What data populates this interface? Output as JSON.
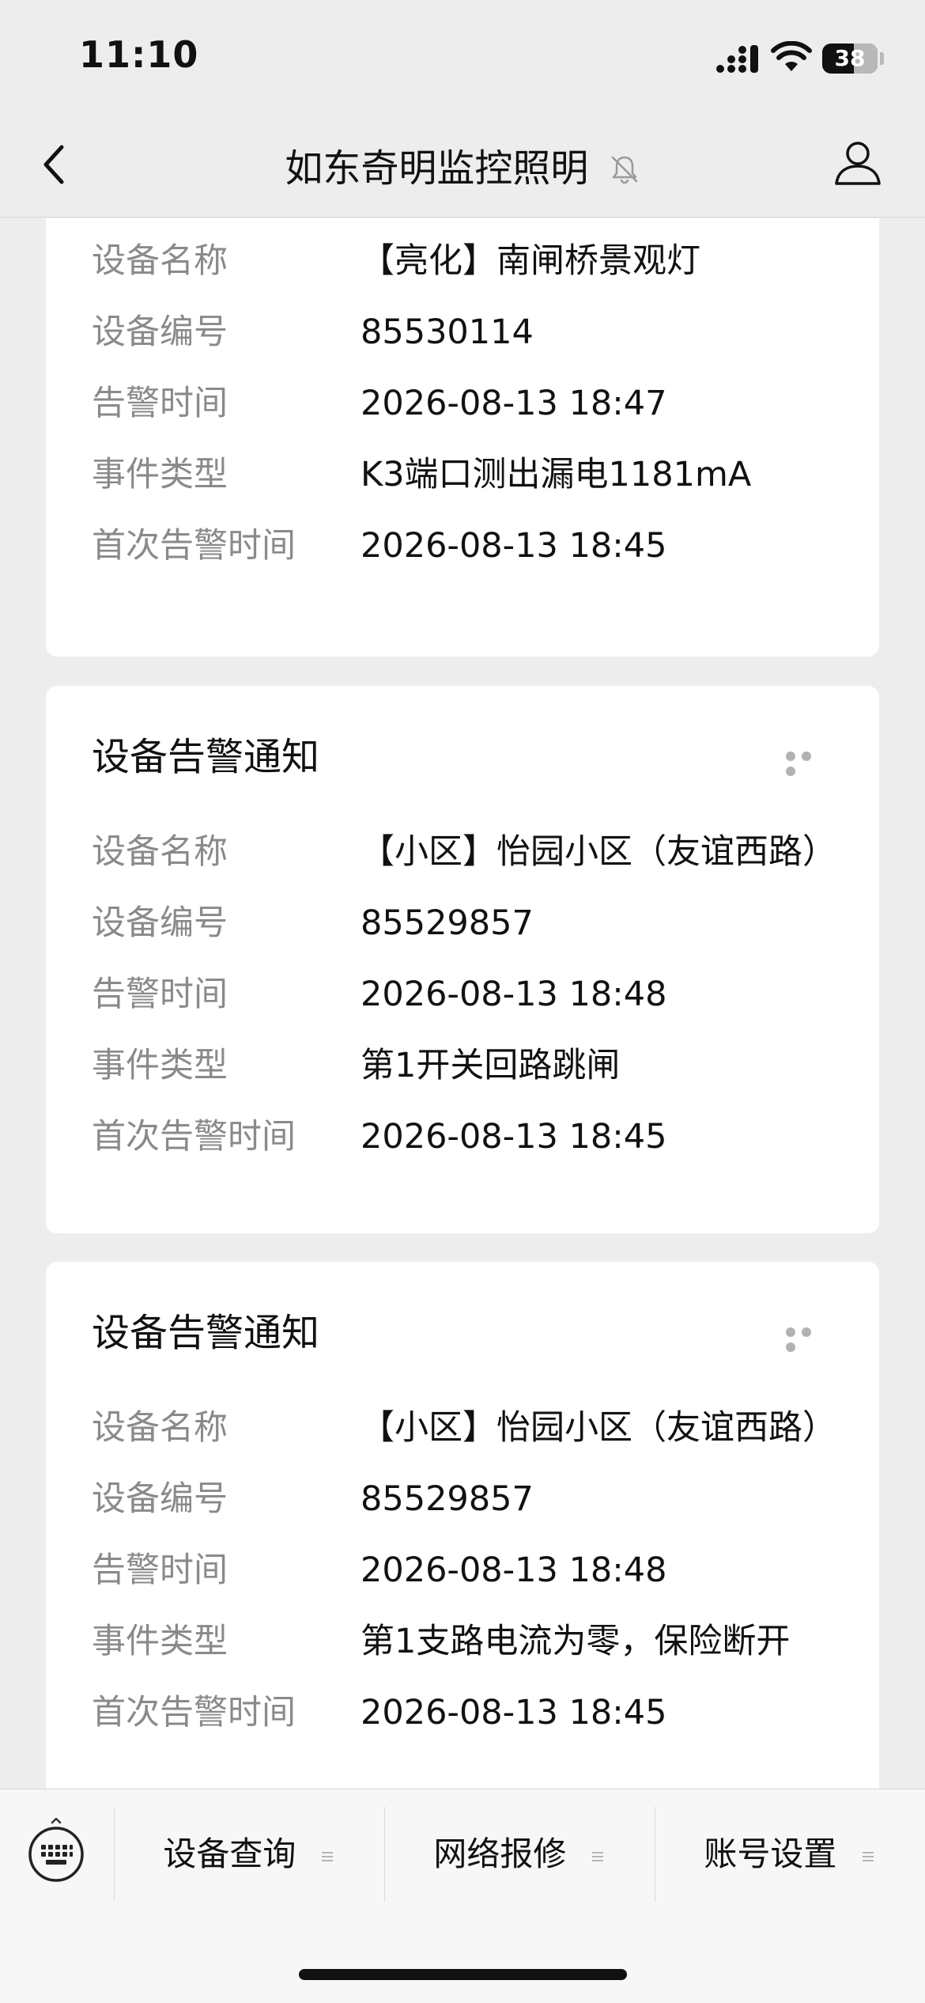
{
  "status_bar": {
    "time": "11:10",
    "battery": "38"
  },
  "nav": {
    "title": "如东奇明监控照明"
  },
  "cards": [
    {
      "title": "",
      "rows": [
        {
          "label": "设备名称",
          "value": "【亮化】南闸桥景观灯"
        },
        {
          "label": "设备编号",
          "value": "85530114"
        },
        {
          "label": "告警时间",
          "value": "2026-08-13 18:47"
        },
        {
          "label": "事件类型",
          "value": "K3端口测出漏电1181mA"
        },
        {
          "label": "首次告警时间",
          "value": "2026-08-13 18:45"
        }
      ]
    },
    {
      "title": "设备告警通知",
      "rows": [
        {
          "label": "设备名称",
          "value": "【小区】怡园小区（友谊西路）"
        },
        {
          "label": "设备编号",
          "value": "85529857"
        },
        {
          "label": "告警时间",
          "value": "2026-08-13 18:48"
        },
        {
          "label": "事件类型",
          "value": "第1开关回路跳闸"
        },
        {
          "label": "首次告警时间",
          "value": "2026-08-13 18:45"
        }
      ]
    },
    {
      "title": "设备告警通知",
      "rows": [
        {
          "label": "设备名称",
          "value": "【小区】怡园小区（友谊西路）"
        },
        {
          "label": "设备编号",
          "value": "85529857"
        },
        {
          "label": "告警时间",
          "value": "2026-08-13 18:48"
        },
        {
          "label": "事件类型",
          "value": "第1支路电流为零，保险断开"
        },
        {
          "label": "首次告警时间",
          "value": "2026-08-13 18:45"
        }
      ]
    }
  ],
  "bottom_menu": {
    "items": [
      {
        "label": "设备查询"
      },
      {
        "label": "网络报修"
      },
      {
        "label": "账号设置"
      }
    ]
  },
  "icons": {
    "back": "chevron-left-icon",
    "mute": "bell-slash-icon",
    "profile": "person-icon",
    "more": "more-dots-icon",
    "keyboard": "keyboard-icon",
    "menu": "menu-lines-icon"
  }
}
